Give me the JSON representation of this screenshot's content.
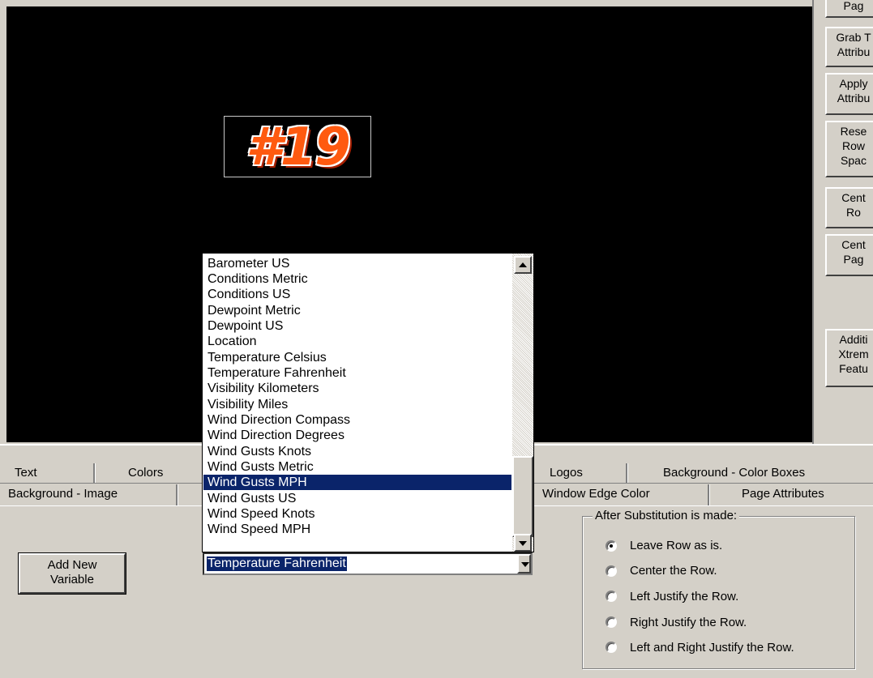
{
  "canvas": {
    "logo_text": "#19"
  },
  "right_panel": {
    "buttons": [
      "Pag",
      "Grab T\nAttribu",
      "Apply\nAttribu",
      "Rese\nRow\nSpac",
      "Cent\nRo",
      "Cent\nPag",
      "Additi\nXtrem\nFeatu"
    ]
  },
  "tabs": {
    "row1": [
      "Text",
      "Colors",
      "Logos",
      "Background - Color Boxes"
    ],
    "row2": [
      "Background - Image",
      "Window Edge Color",
      "Page Attributes"
    ]
  },
  "add_variable_button": "Add New\nVariable",
  "variable_combo": {
    "selected": "Temperature Fahrenheit",
    "list": [
      "Barometer US",
      "Conditions Metric",
      "Conditions US",
      "Dewpoint Metric",
      "Dewpoint US",
      "Location",
      "Temperature Celsius",
      "Temperature Fahrenheit",
      "Visibility Kilometers",
      "Visibility Miles",
      "Wind Direction Compass",
      "Wind Direction Degrees",
      "Wind Gusts Knots",
      "Wind Gusts Metric",
      "Wind Gusts MPH",
      "Wind Gusts US",
      "Wind Speed Knots",
      "Wind Speed MPH"
    ],
    "highlighted": "Wind Gusts MPH"
  },
  "substitution_group": {
    "title": "After Substitution is made:",
    "options": [
      "Leave Row as is.",
      "Center the Row.",
      "Left Justify the Row.",
      "Right Justify the Row.",
      "Left and Right Justify the Row."
    ],
    "selected": "Leave Row as is."
  }
}
